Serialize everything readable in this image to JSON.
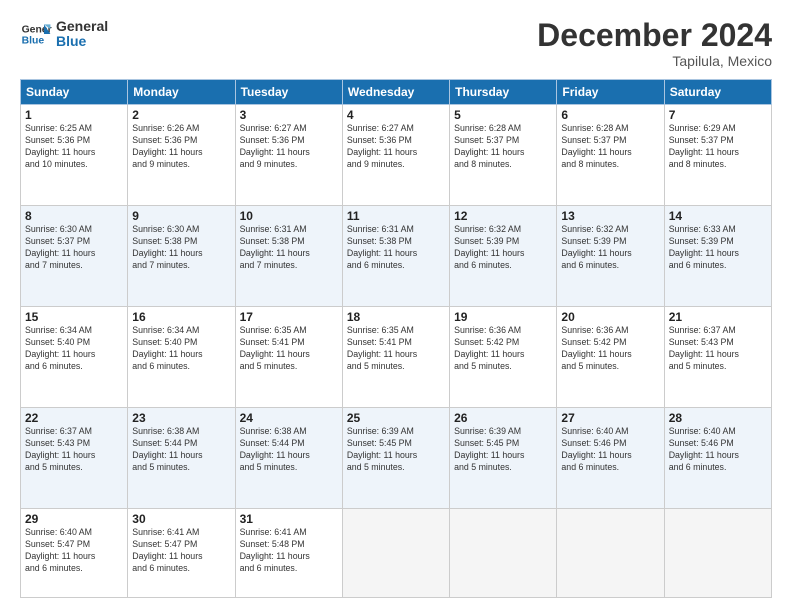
{
  "header": {
    "logo_line1": "General",
    "logo_line2": "Blue",
    "month": "December 2024",
    "location": "Tapilula, Mexico"
  },
  "days_of_week": [
    "Sunday",
    "Monday",
    "Tuesday",
    "Wednesday",
    "Thursday",
    "Friday",
    "Saturday"
  ],
  "weeks": [
    [
      {
        "day": "1",
        "info": "Sunrise: 6:25 AM\nSunset: 5:36 PM\nDaylight: 11 hours\nand 10 minutes."
      },
      {
        "day": "2",
        "info": "Sunrise: 6:26 AM\nSunset: 5:36 PM\nDaylight: 11 hours\nand 9 minutes."
      },
      {
        "day": "3",
        "info": "Sunrise: 6:27 AM\nSunset: 5:36 PM\nDaylight: 11 hours\nand 9 minutes."
      },
      {
        "day": "4",
        "info": "Sunrise: 6:27 AM\nSunset: 5:36 PM\nDaylight: 11 hours\nand 9 minutes."
      },
      {
        "day": "5",
        "info": "Sunrise: 6:28 AM\nSunset: 5:37 PM\nDaylight: 11 hours\nand 8 minutes."
      },
      {
        "day": "6",
        "info": "Sunrise: 6:28 AM\nSunset: 5:37 PM\nDaylight: 11 hours\nand 8 minutes."
      },
      {
        "day": "7",
        "info": "Sunrise: 6:29 AM\nSunset: 5:37 PM\nDaylight: 11 hours\nand 8 minutes."
      }
    ],
    [
      {
        "day": "8",
        "info": "Sunrise: 6:30 AM\nSunset: 5:37 PM\nDaylight: 11 hours\nand 7 minutes."
      },
      {
        "day": "9",
        "info": "Sunrise: 6:30 AM\nSunset: 5:38 PM\nDaylight: 11 hours\nand 7 minutes."
      },
      {
        "day": "10",
        "info": "Sunrise: 6:31 AM\nSunset: 5:38 PM\nDaylight: 11 hours\nand 7 minutes."
      },
      {
        "day": "11",
        "info": "Sunrise: 6:31 AM\nSunset: 5:38 PM\nDaylight: 11 hours\nand 6 minutes."
      },
      {
        "day": "12",
        "info": "Sunrise: 6:32 AM\nSunset: 5:39 PM\nDaylight: 11 hours\nand 6 minutes."
      },
      {
        "day": "13",
        "info": "Sunrise: 6:32 AM\nSunset: 5:39 PM\nDaylight: 11 hours\nand 6 minutes."
      },
      {
        "day": "14",
        "info": "Sunrise: 6:33 AM\nSunset: 5:39 PM\nDaylight: 11 hours\nand 6 minutes."
      }
    ],
    [
      {
        "day": "15",
        "info": "Sunrise: 6:34 AM\nSunset: 5:40 PM\nDaylight: 11 hours\nand 6 minutes."
      },
      {
        "day": "16",
        "info": "Sunrise: 6:34 AM\nSunset: 5:40 PM\nDaylight: 11 hours\nand 6 minutes."
      },
      {
        "day": "17",
        "info": "Sunrise: 6:35 AM\nSunset: 5:41 PM\nDaylight: 11 hours\nand 5 minutes."
      },
      {
        "day": "18",
        "info": "Sunrise: 6:35 AM\nSunset: 5:41 PM\nDaylight: 11 hours\nand 5 minutes."
      },
      {
        "day": "19",
        "info": "Sunrise: 6:36 AM\nSunset: 5:42 PM\nDaylight: 11 hours\nand 5 minutes."
      },
      {
        "day": "20",
        "info": "Sunrise: 6:36 AM\nSunset: 5:42 PM\nDaylight: 11 hours\nand 5 minutes."
      },
      {
        "day": "21",
        "info": "Sunrise: 6:37 AM\nSunset: 5:43 PM\nDaylight: 11 hours\nand 5 minutes."
      }
    ],
    [
      {
        "day": "22",
        "info": "Sunrise: 6:37 AM\nSunset: 5:43 PM\nDaylight: 11 hours\nand 5 minutes."
      },
      {
        "day": "23",
        "info": "Sunrise: 6:38 AM\nSunset: 5:44 PM\nDaylight: 11 hours\nand 5 minutes."
      },
      {
        "day": "24",
        "info": "Sunrise: 6:38 AM\nSunset: 5:44 PM\nDaylight: 11 hours\nand 5 minutes."
      },
      {
        "day": "25",
        "info": "Sunrise: 6:39 AM\nSunset: 5:45 PM\nDaylight: 11 hours\nand 5 minutes."
      },
      {
        "day": "26",
        "info": "Sunrise: 6:39 AM\nSunset: 5:45 PM\nDaylight: 11 hours\nand 5 minutes."
      },
      {
        "day": "27",
        "info": "Sunrise: 6:40 AM\nSunset: 5:46 PM\nDaylight: 11 hours\nand 6 minutes."
      },
      {
        "day": "28",
        "info": "Sunrise: 6:40 AM\nSunset: 5:46 PM\nDaylight: 11 hours\nand 6 minutes."
      }
    ],
    [
      {
        "day": "29",
        "info": "Sunrise: 6:40 AM\nSunset: 5:47 PM\nDaylight: 11 hours\nand 6 minutes."
      },
      {
        "day": "30",
        "info": "Sunrise: 6:41 AM\nSunset: 5:47 PM\nDaylight: 11 hours\nand 6 minutes."
      },
      {
        "day": "31",
        "info": "Sunrise: 6:41 AM\nSunset: 5:48 PM\nDaylight: 11 hours\nand 6 minutes."
      },
      {
        "day": "",
        "info": ""
      },
      {
        "day": "",
        "info": ""
      },
      {
        "day": "",
        "info": ""
      },
      {
        "day": "",
        "info": ""
      }
    ]
  ]
}
